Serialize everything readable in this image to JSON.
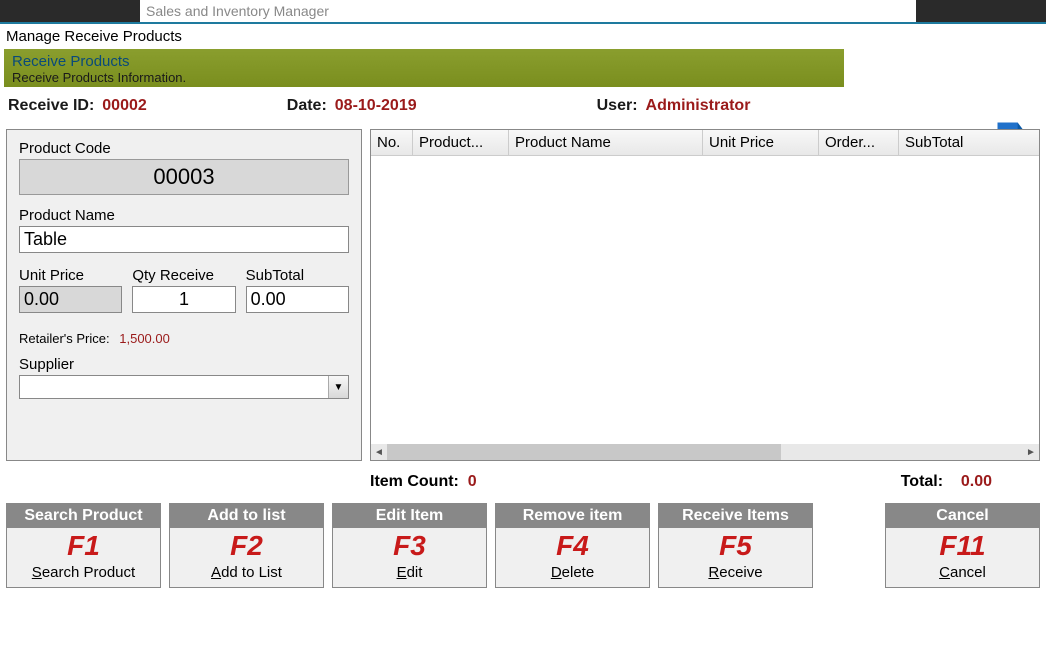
{
  "window": {
    "title": "Sales and Inventory Manager"
  },
  "subtitle": "Manage Receive Products",
  "header_green": {
    "title": "Receive Products",
    "sub": "Receive Products Information."
  },
  "info": {
    "receive_id_label": "Receive ID:",
    "receive_id": "00002",
    "date_label": "Date:",
    "date": "08-10-2019",
    "user_label": "User:",
    "user": "Administrator"
  },
  "form": {
    "code_label": "Product Code",
    "code": "00003",
    "name_label": "Product Name",
    "name": "Table",
    "unitprice_label": "Unit Price",
    "unitprice": "0.00",
    "qty_label": "Qty Receive",
    "qty": "1",
    "subtotal_label": "SubTotal",
    "subtotal": "0.00",
    "retailer_label": "Retailer's Price:",
    "retailer_price": "1,500.00",
    "supplier_label": "Supplier",
    "supplier": ""
  },
  "grid": {
    "cols": {
      "no": "No.",
      "pc": "Product...",
      "pn": "Product Name",
      "up": "Unit Price",
      "oq": "Order...",
      "st": "SubTotal"
    }
  },
  "totals": {
    "item_count_label": "Item Count:",
    "item_count": "0",
    "total_label": "Total:",
    "total": "0.00"
  },
  "buttons": {
    "b1": {
      "hdr": "Search Product",
      "key": "F1",
      "action_u": "S",
      "action_rest": "earch Product"
    },
    "b2": {
      "hdr": "Add to list",
      "key": "F2",
      "action_u": "A",
      "action_rest": "dd to List"
    },
    "b3": {
      "hdr": "Edit Item",
      "key": "F3",
      "action_u": "E",
      "action_rest": "dit"
    },
    "b4": {
      "hdr": "Remove item",
      "key": "F4",
      "action_u": "D",
      "action_rest": "elete"
    },
    "b5": {
      "hdr": "Receive Items",
      "key": "F5",
      "action_u": "R",
      "action_rest": "eceive"
    },
    "b6": {
      "hdr": "Cancel",
      "key": "F11",
      "action_u": "C",
      "action_rest": "ancel"
    }
  }
}
